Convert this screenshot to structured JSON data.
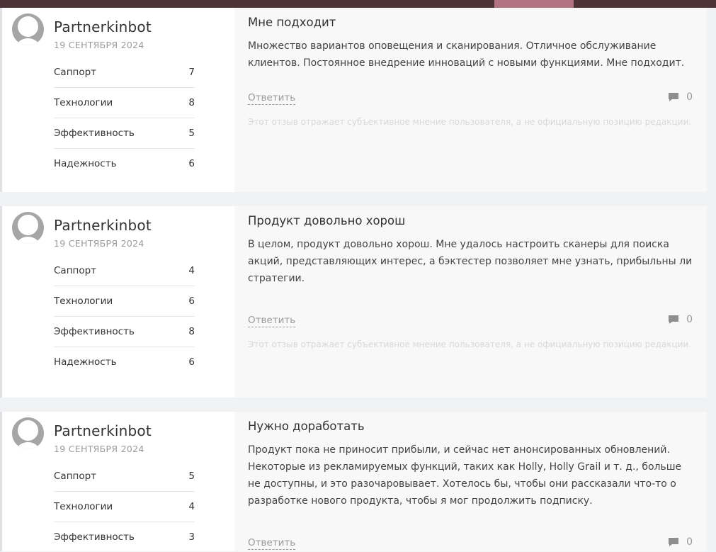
{
  "colors": {
    "topbar": "#4e3336",
    "topbar_tab": "#b2727f",
    "card_bg": "#f8f8f8",
    "sidebar_bg": "#ffffff",
    "muted_text": "#9a9a9a",
    "disclaimer_text": "#d8d8d8"
  },
  "icons": {
    "avatar": "user-avatar-icon",
    "comments": "comment-bubble-icon"
  },
  "reviews": [
    {
      "author": "Partnerkinbot",
      "date": "19 СЕНТЯБРЯ 2024",
      "ratings": [
        {
          "label": "Саппорт",
          "value": "7"
        },
        {
          "label": "Технологии",
          "value": "8"
        },
        {
          "label": "Эффективность",
          "value": "5"
        },
        {
          "label": "Надежность",
          "value": "6"
        }
      ],
      "title": "Мне подходит",
      "text": "Множество вариантов оповещения и сканирования. Отличное обслуживание клиентов. Постоянное внедрение инноваций с новыми функциями. Мне подходит.",
      "reply_label": "Ответить",
      "comment_count": "0",
      "disclaimer": "Этот отзыв отражает субъективное мнение пользователя, а не официальную позицию редакции."
    },
    {
      "author": "Partnerkinbot",
      "date": "19 СЕНТЯБРЯ 2024",
      "ratings": [
        {
          "label": "Саппорт",
          "value": "4"
        },
        {
          "label": "Технологии",
          "value": "6"
        },
        {
          "label": "Эффективность",
          "value": "8"
        },
        {
          "label": "Надежность",
          "value": "6"
        }
      ],
      "title": "Продукт довольно хорош",
      "text": "В целом, продукт довольно хорош. Мне удалось настроить сканеры для поиска акций, представляющих интерес, а бэктестер позволяет мне узнать, прибыльны ли стратегии.",
      "reply_label": "Ответить",
      "comment_count": "0",
      "disclaimer": "Этот отзыв отражает субъективное мнение пользователя, а не официальную позицию редакции."
    },
    {
      "author": "Partnerkinbot",
      "date": "19 СЕНТЯБРЯ 2024",
      "ratings": [
        {
          "label": "Саппорт",
          "value": "5"
        },
        {
          "label": "Технологии",
          "value": "4"
        },
        {
          "label": "Эффективность",
          "value": "3"
        }
      ],
      "title": "Нужно доработать",
      "text": "Продукт пока не приносит прибыли, и сейчас нет анонсированных обновлений. Некоторые из рекламируемых функций, таких как Holly, Holly Grail и т. д., больше не доступны, и это разочаровывает. Хотелось бы, чтобы они рассказали что-то о разработке нового продукта, чтобы я мог продолжить подписку.",
      "reply_label": "Ответить",
      "comment_count": "0"
    }
  ]
}
